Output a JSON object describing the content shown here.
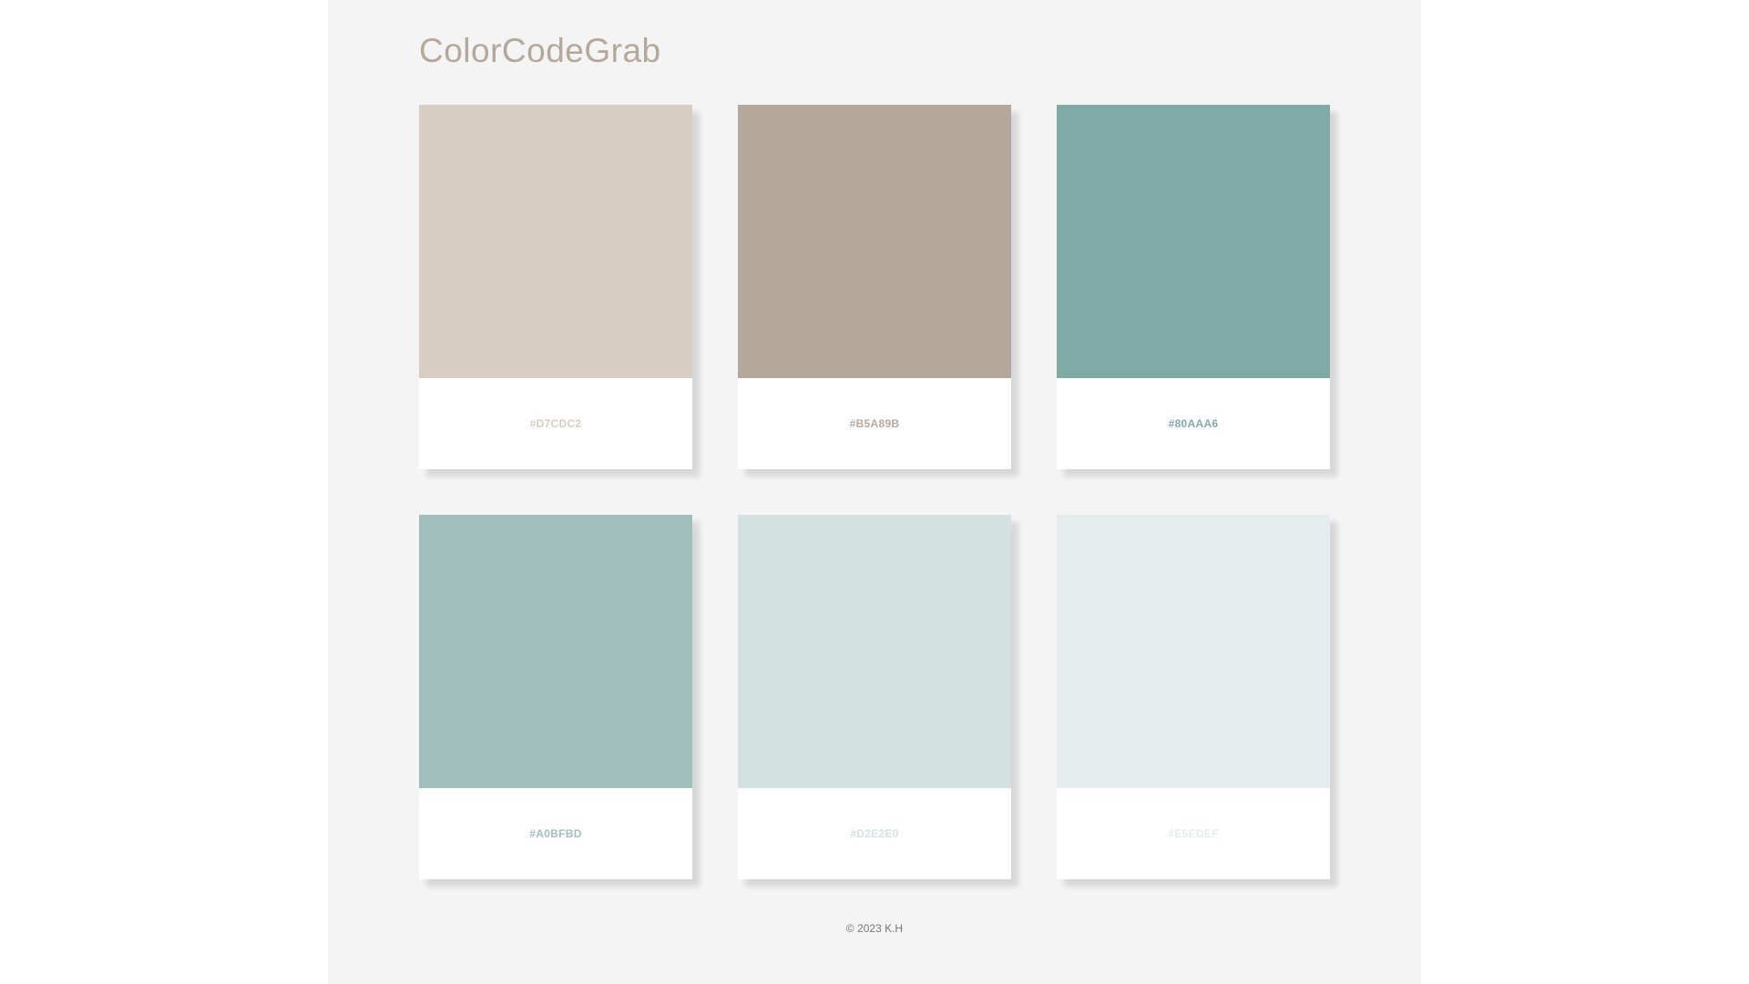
{
  "header": {
    "title": "ColorCodeGrab"
  },
  "colors": [
    {
      "hex": "#D7CDC2",
      "value": "#D7CDC2"
    },
    {
      "hex": "#B5A89B",
      "value": "#B5A89B"
    },
    {
      "hex": "#80AAA6",
      "value": "#80AAA6"
    },
    {
      "hex": "#A0BFBD",
      "value": "#A0BFBD"
    },
    {
      "hex": "#D2E2E0",
      "value": "#D2E2E0"
    },
    {
      "hex": "#E5EDEF",
      "value": "#E5EDEF"
    }
  ],
  "footer": {
    "copyright": "© 2023 K.H"
  }
}
